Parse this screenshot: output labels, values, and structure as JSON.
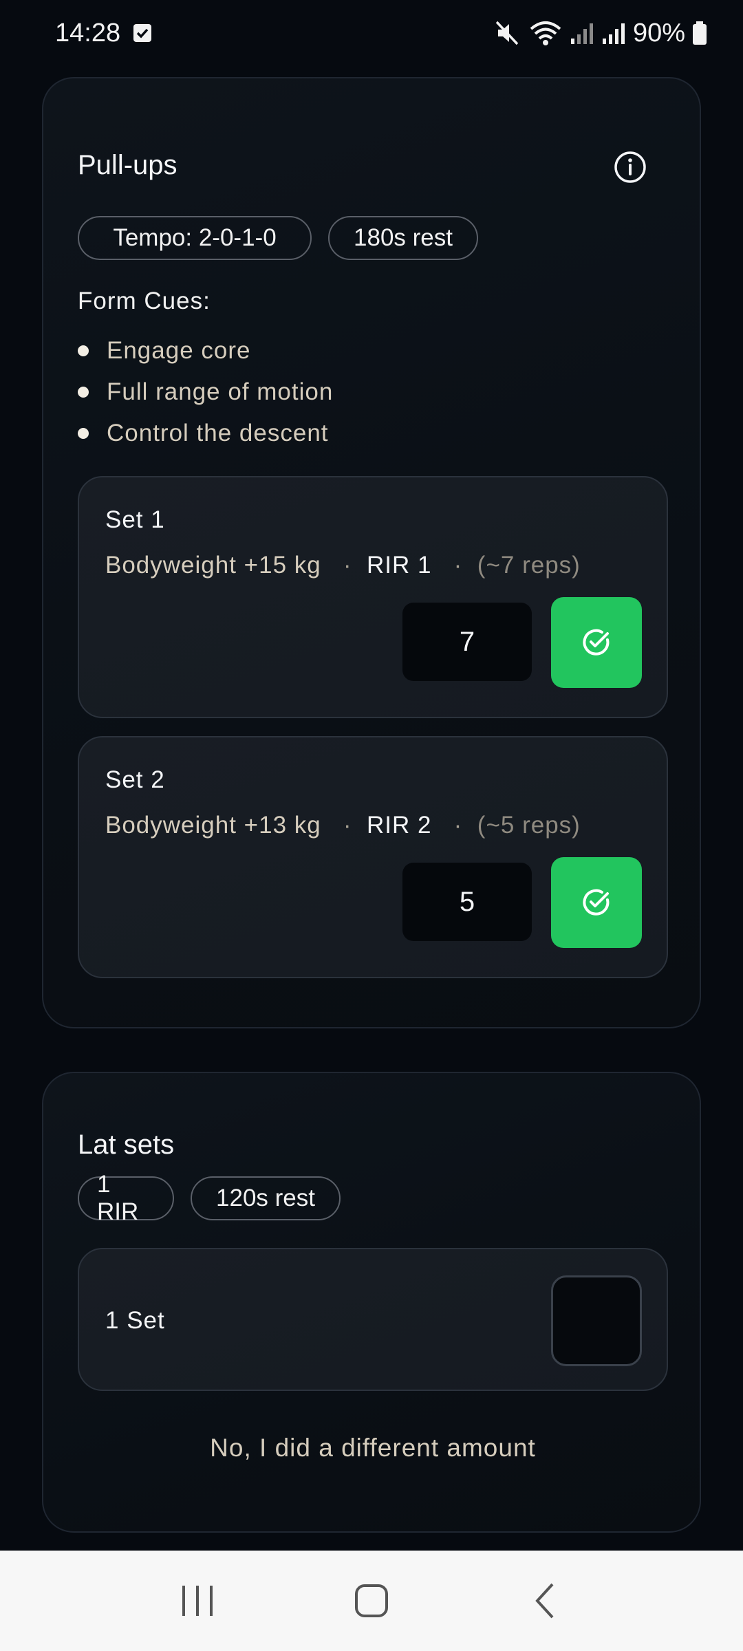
{
  "status_bar": {
    "time": "14:28",
    "battery": "90%"
  },
  "exercise_1": {
    "title": "Pull-ups",
    "chips": [
      "Tempo: 2-0-1-0",
      "180s rest"
    ],
    "form_cues_title": "Form Cues:",
    "form_cues": [
      "Engage core",
      "Full range of motion",
      "Control the descent"
    ],
    "sets": [
      {
        "title": "Set 1",
        "weight": "Bodyweight +15 kg",
        "rir": "RIR 1",
        "reps_hint": "(~7 reps)",
        "reps_value": "7"
      },
      {
        "title": "Set 2",
        "weight": "Bodyweight +13 kg",
        "rir": "RIR 2",
        "reps_hint": "(~5 reps)",
        "reps_value": "5"
      }
    ]
  },
  "exercise_2": {
    "title": "Lat sets",
    "chips": [
      "1 RIR",
      "120s rest"
    ],
    "set_label": "1 Set",
    "different_amount_link": "No, I did a different amount"
  },
  "colors": {
    "accent_green": "#22c55e",
    "background": "#060a10",
    "muted_text": "#d6cdbd"
  },
  "icons": {
    "info": "info-circle-icon",
    "done": "check-circle-icon"
  }
}
